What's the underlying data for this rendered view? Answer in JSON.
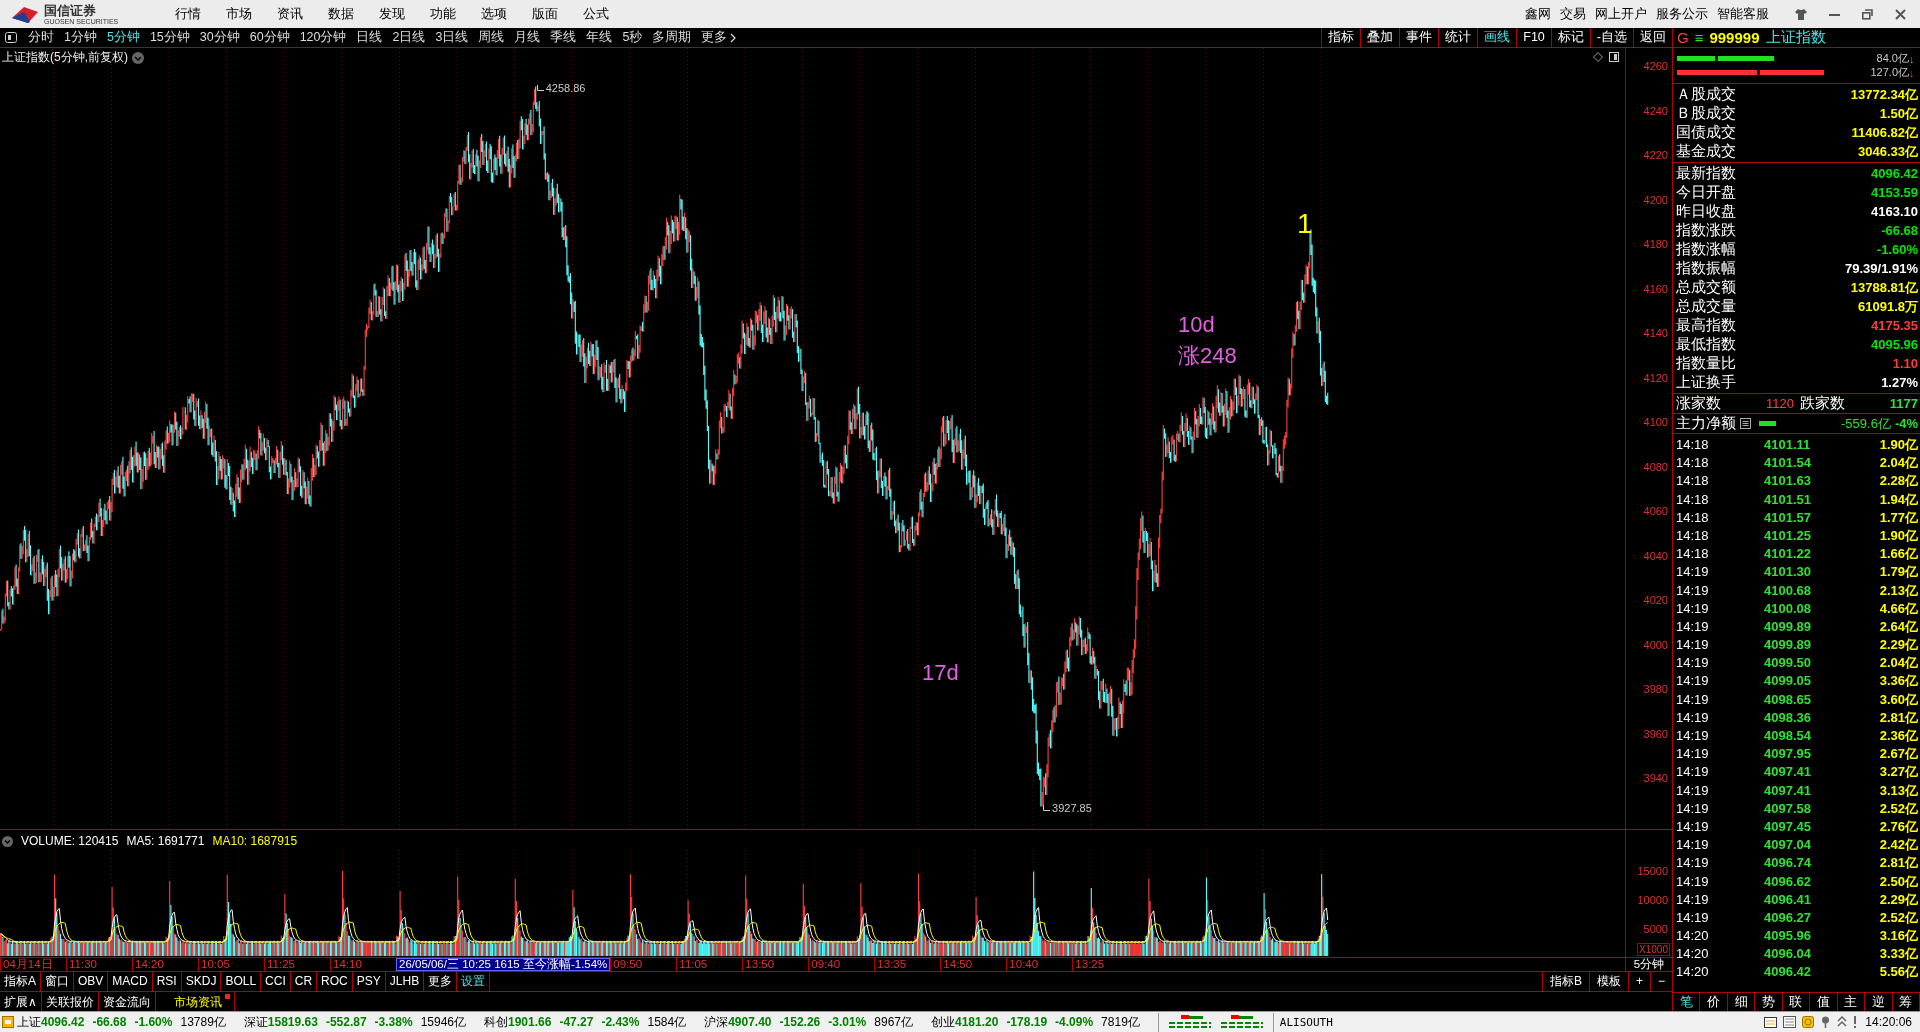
{
  "title_bar": {
    "logo": {
      "name": "国信证券",
      "subtitle": "GUOSEN SECURITIES"
    },
    "menu": [
      "行情",
      "市场",
      "资讯",
      "数据",
      "发现",
      "功能",
      "选项",
      "版面",
      "公式"
    ],
    "links": [
      "鑫网",
      "交易",
      "网上开户",
      "服务公示",
      "智能客服"
    ]
  },
  "toolbar": {
    "periods": [
      {
        "label": "分时",
        "selected": false
      },
      {
        "label": "1分钟",
        "selected": false
      },
      {
        "label": "5分钟",
        "selected": true
      },
      {
        "label": "15分钟",
        "selected": false
      },
      {
        "label": "30分钟",
        "selected": false
      },
      {
        "label": "60分钟",
        "selected": false
      },
      {
        "label": "120分钟",
        "selected": false
      },
      {
        "label": "日线",
        "selected": false
      },
      {
        "label": "2日线",
        "selected": false
      },
      {
        "label": "3日线",
        "selected": false
      },
      {
        "label": "周线",
        "selected": false
      },
      {
        "label": "月线",
        "selected": false
      },
      {
        "label": "季线",
        "selected": false
      },
      {
        "label": "年线",
        "selected": false
      },
      {
        "label": "5秒",
        "selected": false
      },
      {
        "label": "多周期",
        "selected": false
      },
      {
        "label": "更多",
        "selected": false
      }
    ],
    "tools": [
      {
        "label": "指标",
        "selected": false
      },
      {
        "label": "叠加",
        "selected": false
      },
      {
        "label": "事件",
        "selected": false
      },
      {
        "label": "统计",
        "selected": false
      },
      {
        "label": "画线",
        "selected": true
      },
      {
        "label": "F10",
        "selected": false
      },
      {
        "label": "标记",
        "selected": false
      },
      {
        "label": "-自选",
        "selected": false
      },
      {
        "label": "返回",
        "selected": false
      }
    ]
  },
  "chart": {
    "title": "上证指数(5分钟,前复权)",
    "price_ticks": [
      "4260",
      "4240",
      "4220",
      "4200",
      "4180",
      "4160",
      "4140",
      "4120",
      "4100",
      "4080",
      "4060",
      "4040",
      "4020",
      "4000",
      "3980",
      "3960",
      "3940"
    ],
    "high_label": "4258.86",
    "low_label": "3927.85",
    "drawings": [
      {
        "text": "1",
        "color": "#ffff00"
      },
      {
        "text": "10d",
        "color": "#e35fe3"
      },
      {
        "text": "涨248",
        "color": "#e35fe3"
      },
      {
        "text": "17d",
        "color": "#e35fe3"
      }
    ]
  },
  "volume": {
    "volume": "VOLUME: 120415",
    "ma5": "MA5: 1691771",
    "ma10": "MA10: 1687915",
    "ticks": [
      "15000",
      "10000",
      "5000"
    ],
    "unit": "X1000"
  },
  "time_axis": {
    "labels": [
      "04月14日",
      "11:30",
      "14:20",
      "10:05",
      "11:25",
      "14:10",
      "09:50",
      "11:05",
      "13:50",
      "09:40",
      "13:35",
      "14:50",
      "10:40",
      "13:25"
    ],
    "cursor": "26/05/06/三 10:25 1615 至今涨幅-1.54%",
    "period": "5分钟"
  },
  "indicator_bar": {
    "tabs": [
      {
        "label": "指标A",
        "selected": false
      },
      {
        "label": "窗口",
        "selected": false
      },
      {
        "label": "OBV",
        "selected": false
      },
      {
        "label": "MACD",
        "selected": false
      },
      {
        "label": "RSI",
        "selected": false
      },
      {
        "label": "SKDJ",
        "selected": false
      },
      {
        "label": "BOLL",
        "selected": false
      },
      {
        "label": "CCI",
        "selected": false
      },
      {
        "label": "CR",
        "selected": false
      },
      {
        "label": "ROC",
        "selected": false
      },
      {
        "label": "PSY",
        "selected": false
      },
      {
        "label": "JLHB",
        "selected": false
      },
      {
        "label": "更多",
        "selected": false
      },
      {
        "label": "设置",
        "selected": true
      }
    ],
    "right": [
      "指标B",
      "模板",
      "+",
      "−"
    ]
  },
  "extension_bar": {
    "tabs": [
      {
        "label": "扩展∧",
        "selected": false
      },
      {
        "label": "关联报价",
        "selected": false
      },
      {
        "label": "资金流向",
        "selected": false
      },
      {
        "label": "市场资讯",
        "selected": true
      }
    ]
  },
  "right_panel": {
    "header": {
      "market": "G",
      "menu": "≡",
      "code": "999999",
      "name": "上证指数"
    },
    "flows": [
      {
        "kind": "inflow",
        "value": "84.0亿",
        "arrow": "↓"
      },
      {
        "kind": "outflow",
        "value": "127.0亿",
        "arrow": "↓"
      }
    ],
    "turnover": [
      {
        "label": "Ａ股成交",
        "value": "13772.34亿",
        "color": "#ffff00"
      },
      {
        "label": "Ｂ股成交",
        "value": "1.50亿",
        "color": "#ffff00"
      },
      {
        "label": "国债成交",
        "value": "11406.82亿",
        "color": "#ffff00"
      },
      {
        "label": "基金成交",
        "value": "3046.33亿",
        "color": "#ffff00"
      }
    ],
    "stats": [
      {
        "label": "最新指数",
        "value": "4096.42",
        "color": "#00e600"
      },
      {
        "label": "今日开盘",
        "value": "4153.59",
        "color": "#00e600"
      },
      {
        "label": "昨日收盘",
        "value": "4163.10",
        "color": "#ffffff"
      },
      {
        "label": "指数涨跌",
        "value": "-66.68",
        "color": "#00e600"
      },
      {
        "label": "指数涨幅",
        "value": "-1.60%",
        "color": "#00e600"
      },
      {
        "label": "指数振幅",
        "value": "79.39/1.91%",
        "color": "#ffffff"
      },
      {
        "label": "总成交额",
        "value": "13788.81亿",
        "color": "#ffff00"
      },
      {
        "label": "总成交量",
        "value": "61091.8万",
        "color": "#ffff00"
      },
      {
        "label": "最高指数",
        "value": "4175.35",
        "color": "#ff3c3c"
      },
      {
        "label": "最低指数",
        "value": "4095.96",
        "color": "#00e600"
      },
      {
        "label": "指数量比",
        "value": "1.10",
        "color": "#ff3c3c"
      },
      {
        "label": "上证换手",
        "value": "1.27%",
        "color": "#ffffff"
      }
    ],
    "breadth": {
      "up_label": "涨家数",
      "up": "1120",
      "down_label": "跌家数",
      "down": "1177"
    },
    "main_force": {
      "label": "主力净额",
      "level": 0.35,
      "value": "-559.6亿",
      "pct": "-4%"
    },
    "ticks": [
      {
        "time": "14:18",
        "price": "4101.11",
        "volume": "1.90亿"
      },
      {
        "time": "14:18",
        "price": "4101.54",
        "volume": "2.04亿"
      },
      {
        "time": "14:18",
        "price": "4101.63",
        "volume": "2.28亿"
      },
      {
        "time": "14:18",
        "price": "4101.51",
        "volume": "1.94亿"
      },
      {
        "time": "14:18",
        "price": "4101.57",
        "volume": "1.77亿"
      },
      {
        "time": "14:18",
        "price": "4101.25",
        "volume": "1.90亿"
      },
      {
        "time": "14:18",
        "price": "4101.22",
        "volume": "1.66亿"
      },
      {
        "time": "14:19",
        "price": "4101.30",
        "volume": "1.79亿"
      },
      {
        "time": "14:19",
        "price": "4100.68",
        "volume": "2.13亿"
      },
      {
        "time": "14:19",
        "price": "4100.08",
        "volume": "4.66亿"
      },
      {
        "time": "14:19",
        "price": "4099.89",
        "volume": "2.64亿"
      },
      {
        "time": "14:19",
        "price": "4099.89",
        "volume": "2.29亿"
      },
      {
        "time": "14:19",
        "price": "4099.50",
        "volume": "2.04亿"
      },
      {
        "time": "14:19",
        "price": "4099.05",
        "volume": "3.36亿"
      },
      {
        "time": "14:19",
        "price": "4098.65",
        "volume": "3.60亿"
      },
      {
        "time": "14:19",
        "price": "4098.36",
        "volume": "2.81亿"
      },
      {
        "time": "14:19",
        "price": "4098.54",
        "volume": "2.36亿"
      },
      {
        "time": "14:19",
        "price": "4097.95",
        "volume": "2.67亿"
      },
      {
        "time": "14:19",
        "price": "4097.41",
        "volume": "3.27亿"
      },
      {
        "time": "14:19",
        "price": "4097.41",
        "volume": "3.13亿"
      },
      {
        "time": "14:19",
        "price": "4097.58",
        "volume": "2.52亿"
      },
      {
        "time": "14:19",
        "price": "4097.45",
        "volume": "2.76亿"
      },
      {
        "time": "14:19",
        "price": "4097.04",
        "volume": "2.42亿"
      },
      {
        "time": "14:19",
        "price": "4096.74",
        "volume": "2.81亿"
      },
      {
        "time": "14:19",
        "price": "4096.62",
        "volume": "2.50亿"
      },
      {
        "time": "14:19",
        "price": "4096.41",
        "volume": "2.29亿"
      },
      {
        "time": "14:19",
        "price": "4096.27",
        "volume": "2.52亿"
      },
      {
        "time": "14:20",
        "price": "4095.96",
        "volume": "3.16亿"
      },
      {
        "time": "14:20",
        "price": "4096.04",
        "volume": "3.33亿"
      },
      {
        "time": "14:20",
        "price": "4096.42",
        "volume": "5.56亿"
      }
    ],
    "tabs": [
      {
        "label": "笔",
        "selected": true
      },
      {
        "label": "价",
        "selected": false
      },
      {
        "label": "细",
        "selected": false
      },
      {
        "label": "势",
        "selected": false
      },
      {
        "label": "联",
        "selected": false
      },
      {
        "label": "值",
        "selected": false
      },
      {
        "label": "主",
        "selected": false
      },
      {
        "label": "逆",
        "selected": false
      },
      {
        "label": "筹",
        "selected": false
      }
    ]
  },
  "status_bar": {
    "indices": [
      {
        "name": "上证",
        "value": "4096.42",
        "change": "-66.68",
        "pct": "-1.60%",
        "amount": "13789亿"
      },
      {
        "name": "深证",
        "value": "15819.63",
        "change": "-552.87",
        "pct": "-3.38%",
        "amount": "15946亿"
      },
      {
        "name": "科创",
        "value": "1901.66",
        "change": "-47.27",
        "pct": "-2.43%",
        "amount": "1584亿"
      },
      {
        "name": "沪深",
        "value": "4907.40",
        "change": "-152.26",
        "pct": "-3.01%",
        "amount": "8967亿"
      },
      {
        "name": "创业",
        "value": "4181.20",
        "change": "-178.19",
        "pct": "-4.09%",
        "amount": "7819亿"
      }
    ],
    "server": "ALISOUTH",
    "time": "14:20:06"
  }
}
